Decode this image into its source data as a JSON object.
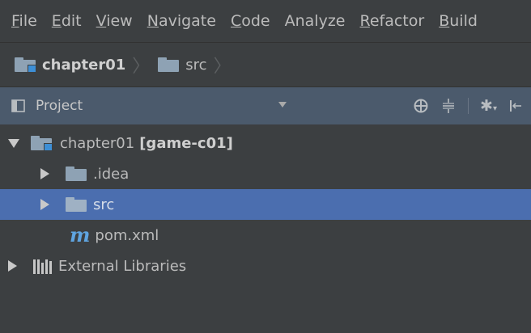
{
  "menu": {
    "items": [
      {
        "mnemonic": "F",
        "rest": "ile"
      },
      {
        "mnemonic": "E",
        "rest": "dit"
      },
      {
        "mnemonic": "V",
        "rest": "iew"
      },
      {
        "mnemonic": "N",
        "rest": "avigate"
      },
      {
        "mnemonic": "C",
        "rest": "ode"
      },
      {
        "mnemonic": "",
        "rest": "Analyze"
      },
      {
        "mnemonic": "R",
        "rest": "efactor"
      },
      {
        "mnemonic": "B",
        "rest": "uild"
      }
    ]
  },
  "breadcrumb": {
    "items": [
      {
        "label": "chapter01",
        "icon": "module-folder-icon"
      },
      {
        "label": "src",
        "icon": "folder-icon"
      }
    ]
  },
  "tool_window": {
    "title": "Project",
    "icons": [
      "locate-icon",
      "collapse-all-icon",
      "gear-icon",
      "hide-icon"
    ]
  },
  "tree": {
    "items": [
      {
        "label": "chapter01",
        "tag": "[game-c01]",
        "icon": "module-folder-icon",
        "expanded": true,
        "selected": false
      },
      {
        "label": ".idea",
        "icon": "folder-icon",
        "expanded": false,
        "selected": false
      },
      {
        "label": "src",
        "icon": "folder-icon",
        "expanded": false,
        "selected": true
      },
      {
        "label": "pom.xml",
        "icon": "maven-icon",
        "icon_glyph": "m",
        "selected": false
      },
      {
        "label": "External Libraries",
        "icon": "libraries-icon",
        "expanded": false,
        "selected": false
      }
    ]
  },
  "colors": {
    "background": "#3c3f41",
    "header": "#4b5a6c",
    "selection": "#4b6eaf",
    "text": "#bbbbbb",
    "maven": "#5fa4e0"
  }
}
